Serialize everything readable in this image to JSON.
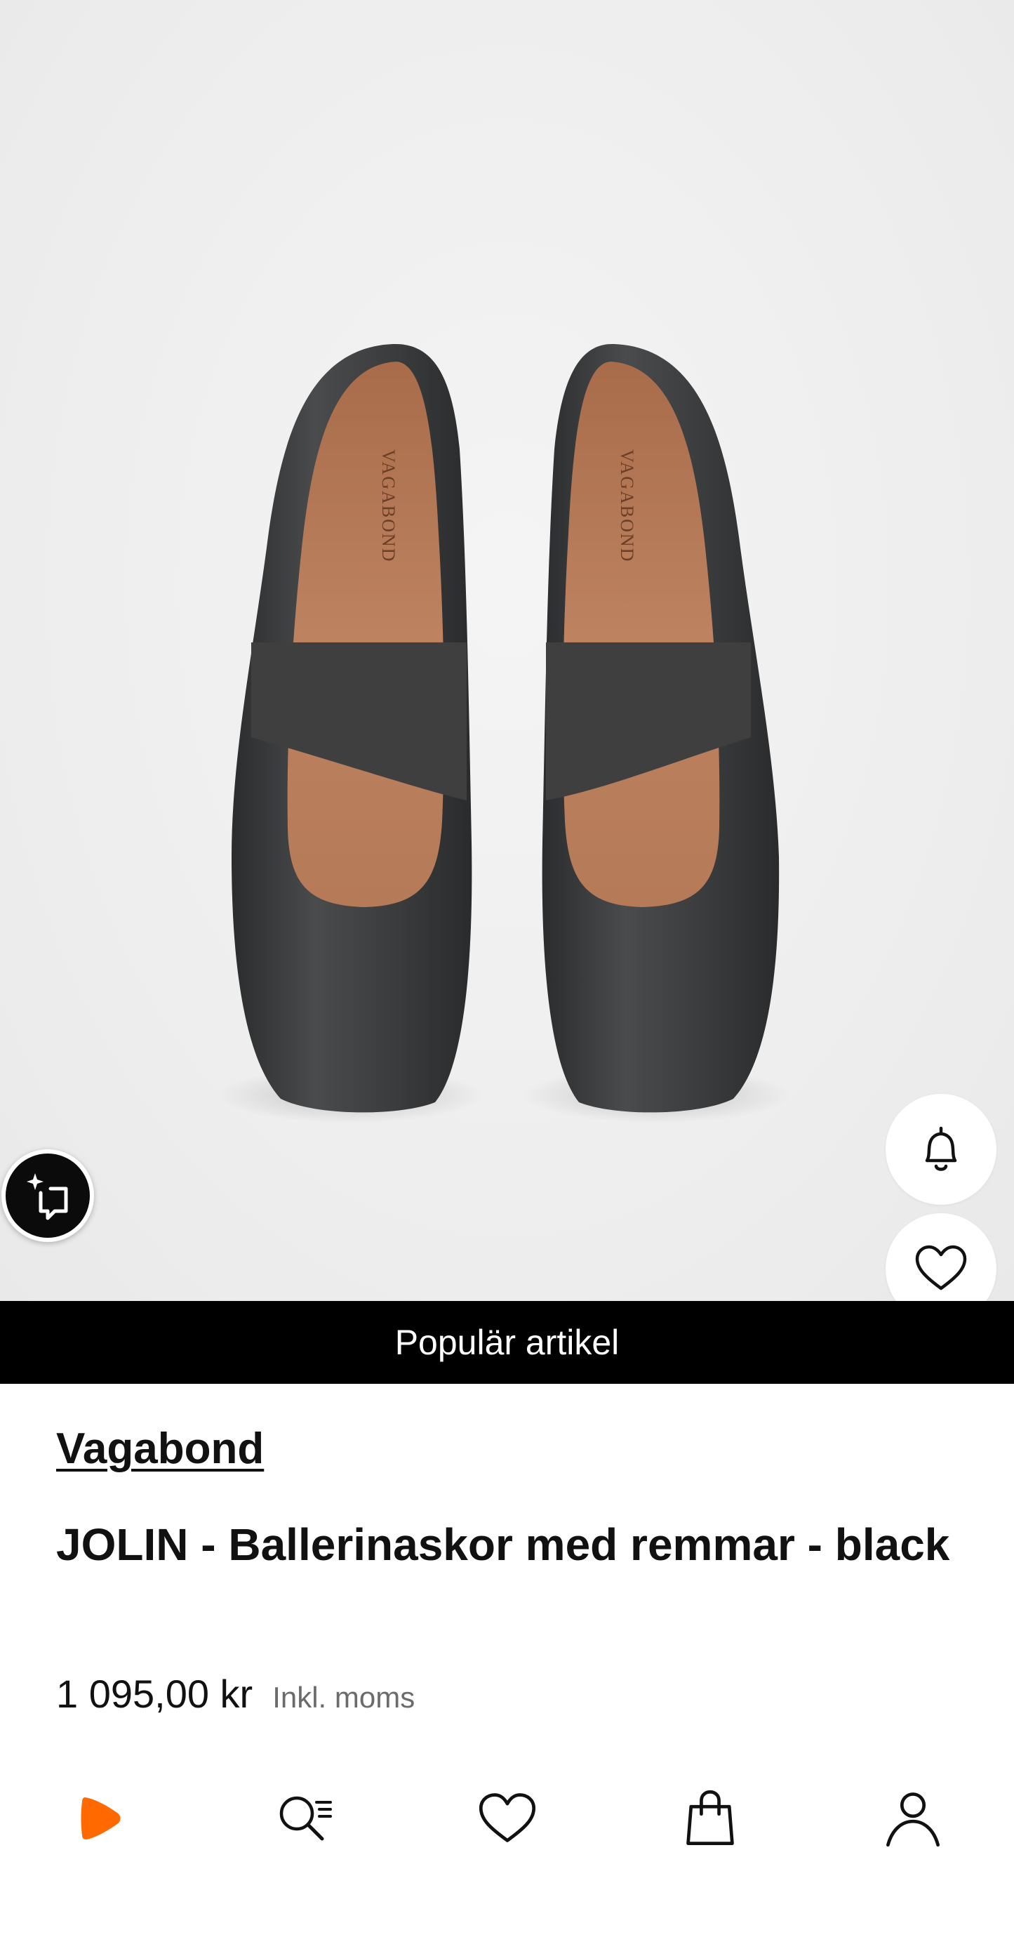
{
  "banner": {
    "label": "Populär artikel"
  },
  "product": {
    "brand": "Vagabond",
    "title": "JOLIN - Ballerinaskor med remmar - black",
    "price": "1 095,00 kr",
    "tax_note": "Inkl. moms",
    "insole_logo": "VAGABOND"
  },
  "actions": {
    "ai_assistant_icon": "sparkle-chat-icon",
    "notify_icon": "bell-icon",
    "wishlist_icon": "heart-icon"
  },
  "nav": {
    "items": [
      {
        "icon": "zalando-play-logo-icon"
      },
      {
        "icon": "search-list-icon"
      },
      {
        "icon": "heart-icon"
      },
      {
        "icon": "shopping-bag-icon"
      },
      {
        "icon": "user-icon"
      }
    ]
  },
  "colors": {
    "accent": "#ff6900",
    "banner_bg": "#000000",
    "shoe_leather": "#3a3b3c",
    "insole": "#b77a56"
  }
}
